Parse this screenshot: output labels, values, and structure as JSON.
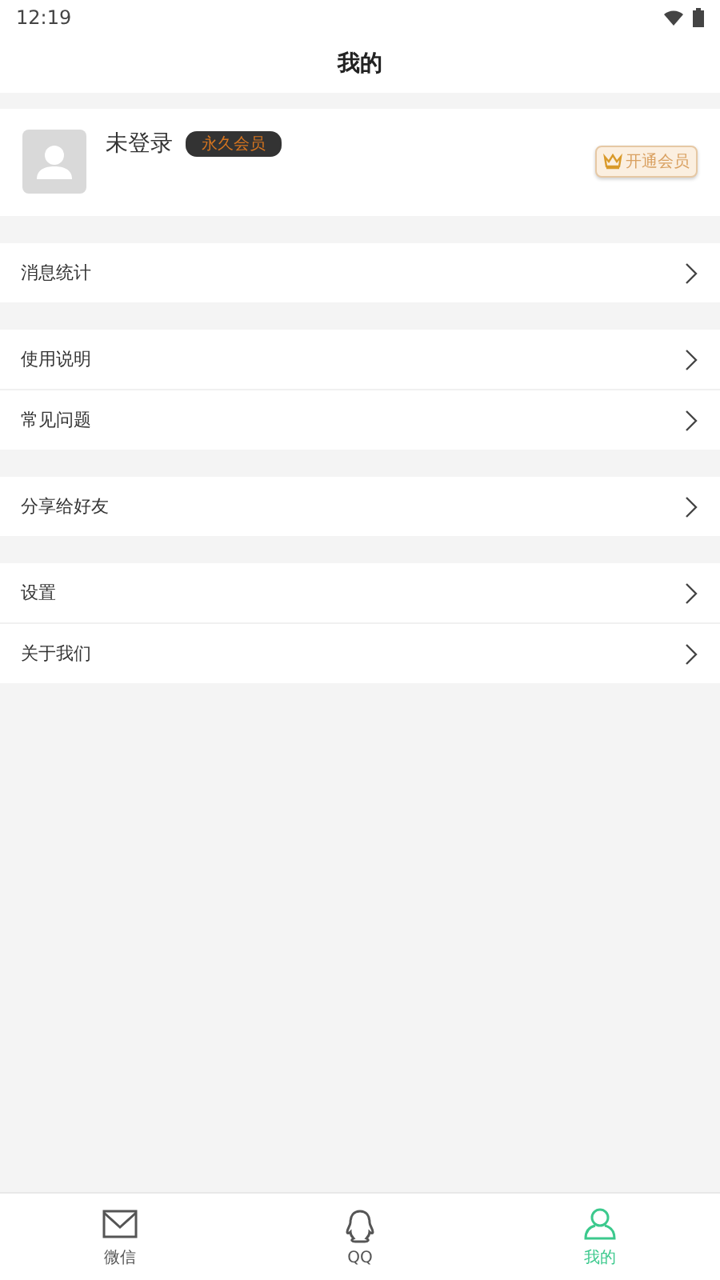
{
  "status_bar": {
    "time": "12:19"
  },
  "title": "我的",
  "profile": {
    "name": "未登录",
    "badge": "永久会员",
    "vip_button": "开通会员"
  },
  "menu_groups": [
    {
      "items": [
        "消息统计"
      ]
    },
    {
      "items": [
        "使用说明",
        "常见问题"
      ]
    },
    {
      "items": [
        "分享给好友"
      ]
    },
    {
      "items": [
        "设置",
        "关于我们"
      ]
    }
  ],
  "tabs": [
    {
      "label": "微信",
      "kind": "mail",
      "selected": false
    },
    {
      "label": "QQ",
      "kind": "qq",
      "selected": false
    },
    {
      "label": "我的",
      "kind": "person",
      "selected": true
    }
  ]
}
